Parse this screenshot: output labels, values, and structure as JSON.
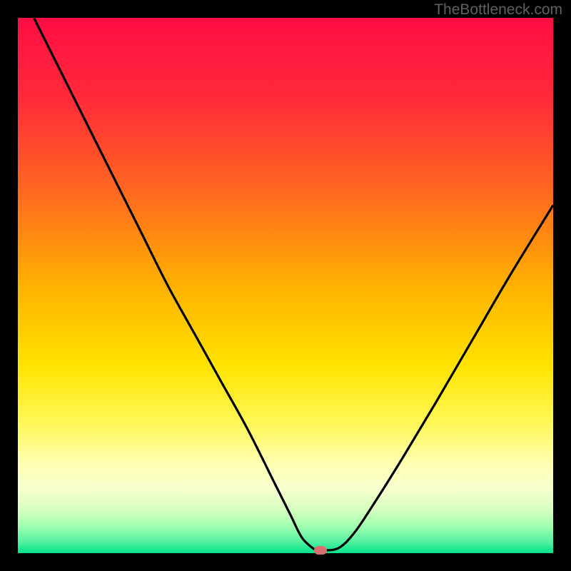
{
  "watermark": "TheBottleneck.com",
  "chart_data": {
    "type": "line",
    "title": "",
    "xlabel": "",
    "ylabel": "",
    "xlim": [
      0,
      100
    ],
    "ylim": [
      0,
      100
    ],
    "series": [
      {
        "name": "bottleneck-curve",
        "x": [
          3,
          8,
          13,
          18,
          23,
          28,
          33,
          38,
          43,
          48,
          51,
          53,
          55,
          56,
          57,
          60,
          63,
          67,
          72,
          78,
          85,
          92,
          100
        ],
        "y": [
          100,
          90,
          80,
          70,
          60,
          50,
          41,
          32,
          23,
          13,
          7,
          3,
          1,
          0.5,
          0.5,
          1,
          4,
          10,
          18,
          28,
          40,
          52,
          65
        ]
      }
    ],
    "marker": {
      "x": 56.5,
      "y": 0.5
    },
    "gradient_stops": [
      {
        "pos": 0,
        "color": "#ff0d44"
      },
      {
        "pos": 15,
        "color": "#ff2a3a"
      },
      {
        "pos": 33,
        "color": "#ff6a1f"
      },
      {
        "pos": 50,
        "color": "#ffb100"
      },
      {
        "pos": 65,
        "color": "#ffe300"
      },
      {
        "pos": 76,
        "color": "#fff85a"
      },
      {
        "pos": 83,
        "color": "#ffffb0"
      },
      {
        "pos": 88,
        "color": "#f7ffd0"
      },
      {
        "pos": 92,
        "color": "#d5ffc0"
      },
      {
        "pos": 95,
        "color": "#9fffb0"
      },
      {
        "pos": 98,
        "color": "#50f0a0"
      },
      {
        "pos": 100,
        "color": "#00e28a"
      }
    ]
  }
}
